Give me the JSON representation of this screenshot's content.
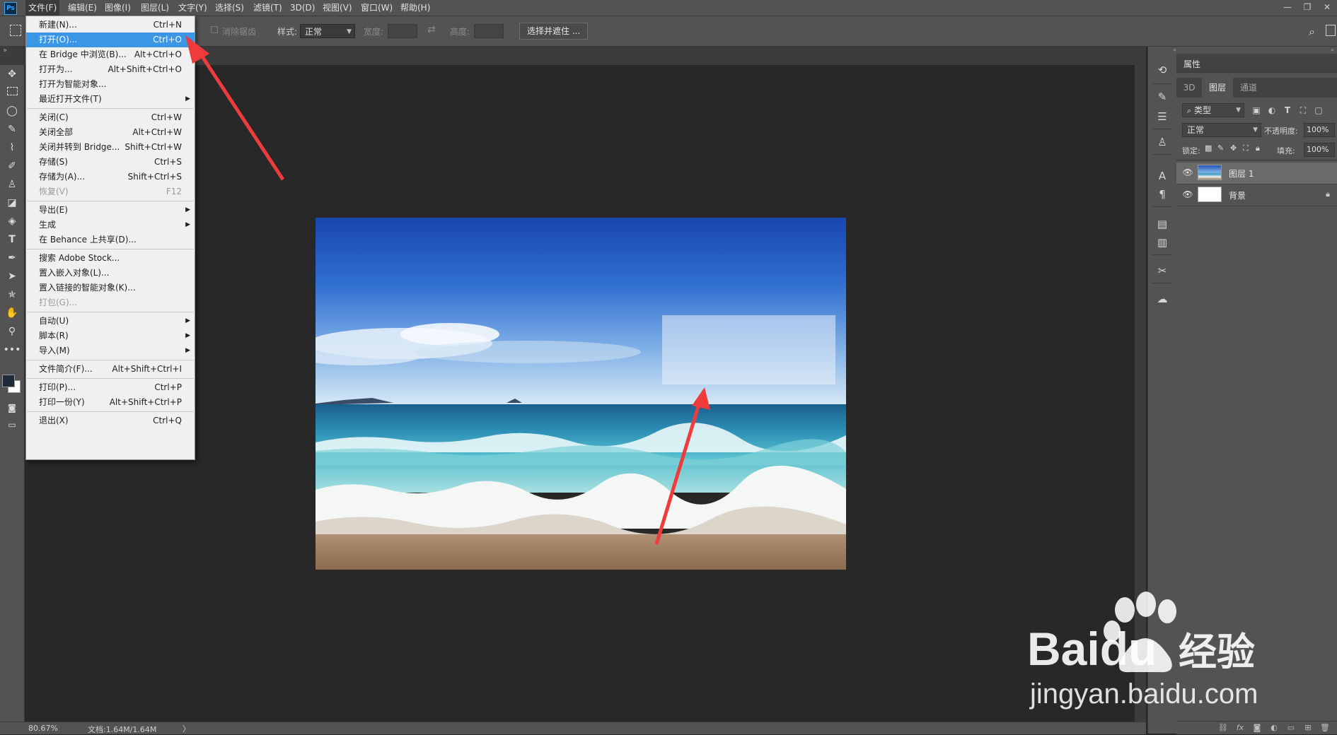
{
  "app": {
    "logo_text": "Ps"
  },
  "menubar": {
    "items": [
      "文件(F)",
      "编辑(E)",
      "图像(I)",
      "图层(L)",
      "文字(Y)",
      "选择(S)",
      "滤镜(T)",
      "3D(D)",
      "视图(V)",
      "窗口(W)",
      "帮助(H)"
    ],
    "window_controls": [
      "—",
      "❐",
      "✕"
    ]
  },
  "options_bar": {
    "feather_label": "消除锯齿",
    "style_label": "样式:",
    "style_value": "正常",
    "width_label": "宽度:",
    "height_label": "高度:",
    "select_mask_button": "选择并遮住 ..."
  },
  "file_menu": {
    "items": [
      {
        "label": "新建(N)...",
        "shortcut": "Ctrl+N"
      },
      {
        "label": "打开(O)...",
        "shortcut": "Ctrl+O",
        "highlighted": true
      },
      {
        "label": "在 Bridge 中浏览(B)...",
        "shortcut": "Alt+Ctrl+O"
      },
      {
        "label": "打开为...",
        "shortcut": "Alt+Shift+Ctrl+O"
      },
      {
        "label": "打开为智能对象...",
        "shortcut": ""
      },
      {
        "label": "最近打开文件(T)",
        "shortcut": "",
        "submenu": true
      },
      {
        "separator": true
      },
      {
        "label": "关闭(C)",
        "shortcut": "Ctrl+W"
      },
      {
        "label": "关闭全部",
        "shortcut": "Alt+Ctrl+W"
      },
      {
        "label": "关闭并转到 Bridge...",
        "shortcut": "Shift+Ctrl+W"
      },
      {
        "label": "存储(S)",
        "shortcut": "Ctrl+S"
      },
      {
        "label": "存储为(A)...",
        "shortcut": "Shift+Ctrl+S"
      },
      {
        "label": "恢复(V)",
        "shortcut": "F12",
        "disabled": true
      },
      {
        "separator": true
      },
      {
        "label": "导出(E)",
        "shortcut": "",
        "submenu": true
      },
      {
        "label": "生成",
        "shortcut": "",
        "submenu": true
      },
      {
        "label": "在 Behance 上共享(D)...",
        "shortcut": ""
      },
      {
        "separator": true
      },
      {
        "label": "搜索 Adobe Stock...",
        "shortcut": ""
      },
      {
        "label": "置入嵌入对象(L)...",
        "shortcut": ""
      },
      {
        "label": "置入链接的智能对象(K)...",
        "shortcut": ""
      },
      {
        "label": "打包(G)...",
        "shortcut": "",
        "disabled": true
      },
      {
        "separator": true
      },
      {
        "label": "自动(U)",
        "shortcut": "",
        "submenu": true
      },
      {
        "label": "脚本(R)",
        "shortcut": "",
        "submenu": true
      },
      {
        "label": "导入(M)",
        "shortcut": "",
        "submenu": true
      },
      {
        "separator": true
      },
      {
        "label": "文件简介(F)...",
        "shortcut": "Alt+Shift+Ctrl+I"
      },
      {
        "separator": true
      },
      {
        "label": "打印(P)...",
        "shortcut": "Ctrl+P"
      },
      {
        "label": "打印一份(Y)",
        "shortcut": "Alt+Shift+Ctrl+P"
      },
      {
        "separator": true
      },
      {
        "label": "退出(X)",
        "shortcut": "Ctrl+Q"
      }
    ]
  },
  "status_bar": {
    "zoom": "80.67%",
    "doc_info": "文档:1.64M/1.64M",
    "arrow": "〉"
  },
  "properties_panel": {
    "title": "属性"
  },
  "layers_panel": {
    "tabs": [
      "3D",
      "图层",
      "通道"
    ],
    "active_tab": "图层",
    "filter_kind": "类型",
    "blend_mode": "正常",
    "opacity_label": "不透明度:",
    "opacity_value": "100%",
    "lock_label": "锁定:",
    "fill_label": "填充:",
    "fill_value": "100%",
    "layers": [
      {
        "name": "图层 1",
        "visible": true,
        "selected": true,
        "locked": false
      },
      {
        "name": "背景",
        "visible": true,
        "selected": false,
        "locked": true
      }
    ]
  },
  "watermark": {
    "brand": "Baidu",
    "suffix": "经验",
    "url": "jingyan.baidu.com"
  },
  "colors": {
    "accent_highlight": "#3b97e6",
    "arrow": "#ef3b3b",
    "menu_bg": "#f0f0f0",
    "panel_bg": "#535353",
    "canvas_bg": "#282828"
  }
}
